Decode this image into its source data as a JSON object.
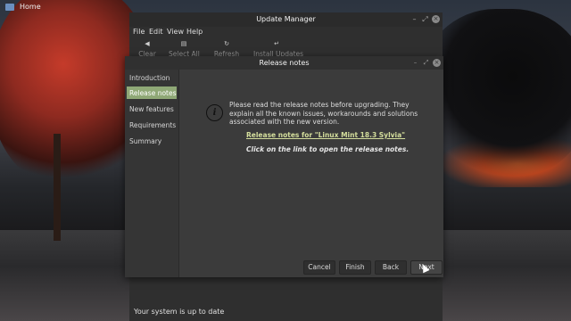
{
  "desktop": {
    "home_label": "Home"
  },
  "update_manager": {
    "title": "Update Manager",
    "menu": [
      "File",
      "Edit",
      "View",
      "Help"
    ],
    "toolbar": [
      {
        "label": "Clear",
        "icon": "eraser-icon"
      },
      {
        "label": "Select All",
        "icon": "document-icon"
      },
      {
        "label": "Refresh",
        "icon": "refresh-icon"
      },
      {
        "label": "Install Updates",
        "icon": "install-icon"
      }
    ],
    "status": "Your system is up to date"
  },
  "dialog": {
    "title": "Release notes",
    "sidebar": [
      {
        "label": "Introduction"
      },
      {
        "label": "Release notes",
        "active": true
      },
      {
        "label": "New features"
      },
      {
        "label": "Requirements"
      },
      {
        "label": "Summary"
      }
    ],
    "info_text": "Please read the release notes before upgrading. They explain all the known issues, workarounds and solutions associated with the new version.",
    "link_text": "Release notes for \"Linux Mint 18.3 Sylvia\"",
    "hint_text": "Click on the link to open the release notes.",
    "buttons": {
      "cancel": "Cancel",
      "finish": "Finish",
      "back": "Back",
      "next": "Next"
    }
  },
  "colors": {
    "accent": "#8fa876",
    "link": "#d4de9c",
    "window_bg": "#383838"
  }
}
